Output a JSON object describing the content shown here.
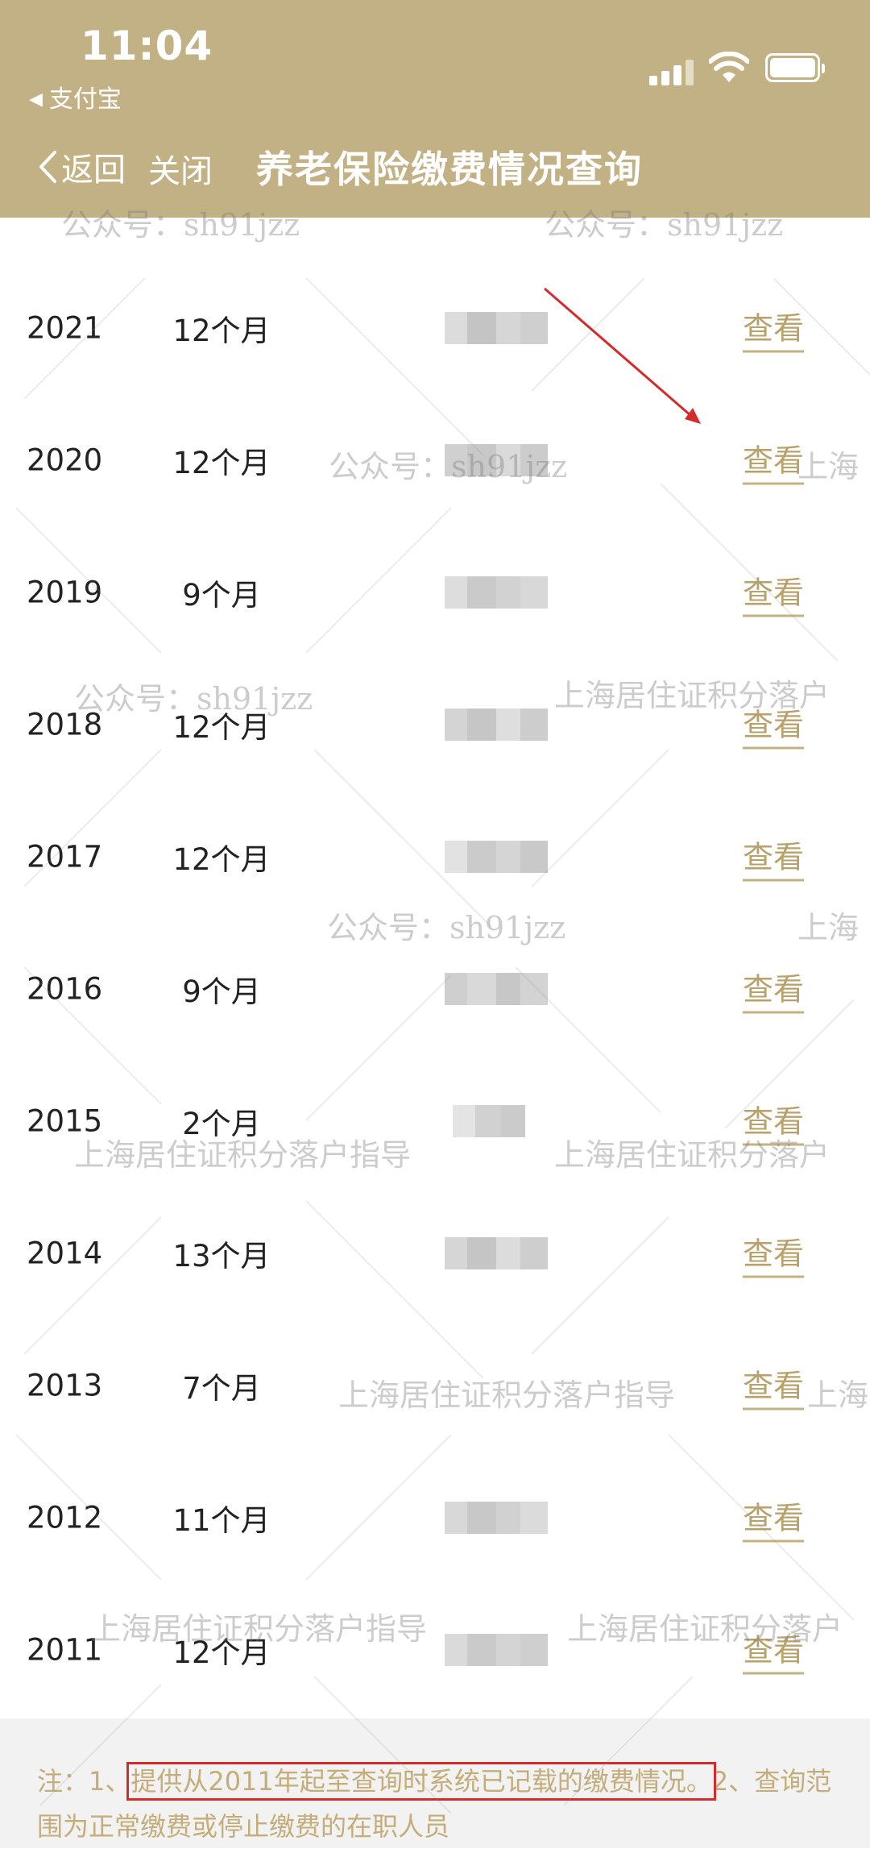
{
  "status_bar": {
    "time": "11:04",
    "back_app": "支付宝"
  },
  "nav": {
    "back": "返回",
    "close": "关闭",
    "title": "养老保险缴费情况查询"
  },
  "rows": [
    {
      "year": "2021",
      "months": "12个月",
      "action": "查看"
    },
    {
      "year": "2020",
      "months": "12个月",
      "action": "查看"
    },
    {
      "year": "2019",
      "months": "9个月",
      "action": "查看"
    },
    {
      "year": "2018",
      "months": "12个月",
      "action": "查看"
    },
    {
      "year": "2017",
      "months": "12个月",
      "action": "查看"
    },
    {
      "year": "2016",
      "months": "9个月",
      "action": "查看"
    },
    {
      "year": "2015",
      "months": "2个月",
      "action": "查看"
    },
    {
      "year": "2014",
      "months": "13个月",
      "action": "查看"
    },
    {
      "year": "2013",
      "months": "7个月",
      "action": "查看"
    },
    {
      "year": "2012",
      "months": "11个月",
      "action": "查看"
    },
    {
      "year": "2011",
      "months": "12个月",
      "action": "查看"
    }
  ],
  "note": {
    "prefix": "注：1、",
    "highlight": "提供从2011年起至查询时系统已记载的缴费情况。",
    "suffix": "2、查询范围为正常缴费或停止缴费的在职人员"
  },
  "watermarks": {
    "account": "公众号：sh91jzz",
    "brand": "上海居住证积分落户指导",
    "brand_partial_long": "上海居住证积分落户",
    "brand_partial_short": "上海",
    "brand_partial_mid": "上海居"
  },
  "colors": {
    "header": "#c2b184",
    "link": "#b8a26a",
    "note_text": "#c4ad78",
    "highlight_box": "#d42b2b",
    "annotation_arrow": "#d42b2b"
  },
  "icons": [
    "back-chevron-icon",
    "signal-icon",
    "wifi-icon",
    "battery-icon",
    "back-triangle-icon"
  ]
}
